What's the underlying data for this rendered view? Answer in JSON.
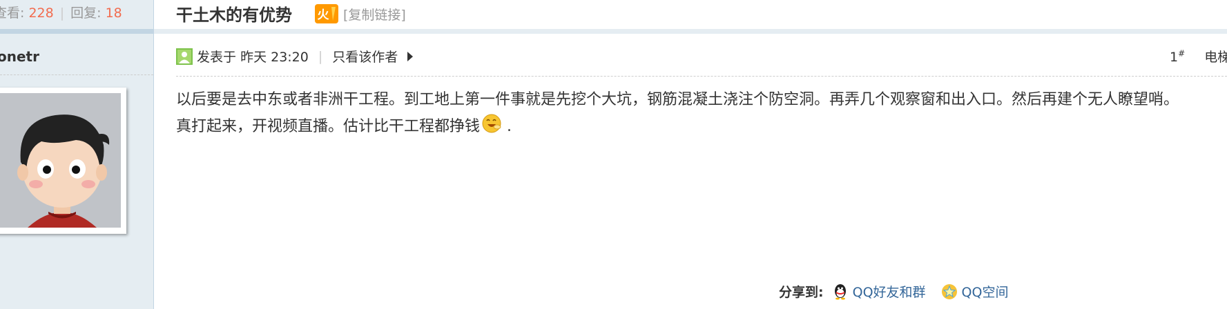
{
  "stats": {
    "views_label": "查看:",
    "views_value": "228",
    "separator": "|",
    "replies_label": "回复:",
    "replies_value": "18"
  },
  "author": {
    "name": "onetr"
  },
  "thread": {
    "title": "干土木的有优势",
    "hot_badge": "火",
    "copy_link": "[复制链接]"
  },
  "post": {
    "posted_prefix": "发表于",
    "posted_time": "昨天 23:20",
    "meta_separator": "|",
    "only_author": "只看该作者",
    "floor_number": "1",
    "floor_mark": "#",
    "elevator": "电梯",
    "body_line1": "以后要是去中东或者非洲干工程。到工地上第一件事就是先挖个大坑，钢筋混凝土浇注个防空洞。再弄几个观察窗和出入口。然后再建个无人瞭望哨。",
    "body_line2": "真打起来，开视频直播。估计比干工程都挣钱",
    "body_end": "."
  },
  "share": {
    "label": "分享到:",
    "qq_friends": "QQ好友和群",
    "qq_zone": "QQ空间"
  },
  "colors": {
    "sidebar_bg": "#e5edf2",
    "band": "#c2d5e3",
    "stat_number": "#f26c4f",
    "link": "#336699",
    "hot_badge": "#ff9900"
  }
}
